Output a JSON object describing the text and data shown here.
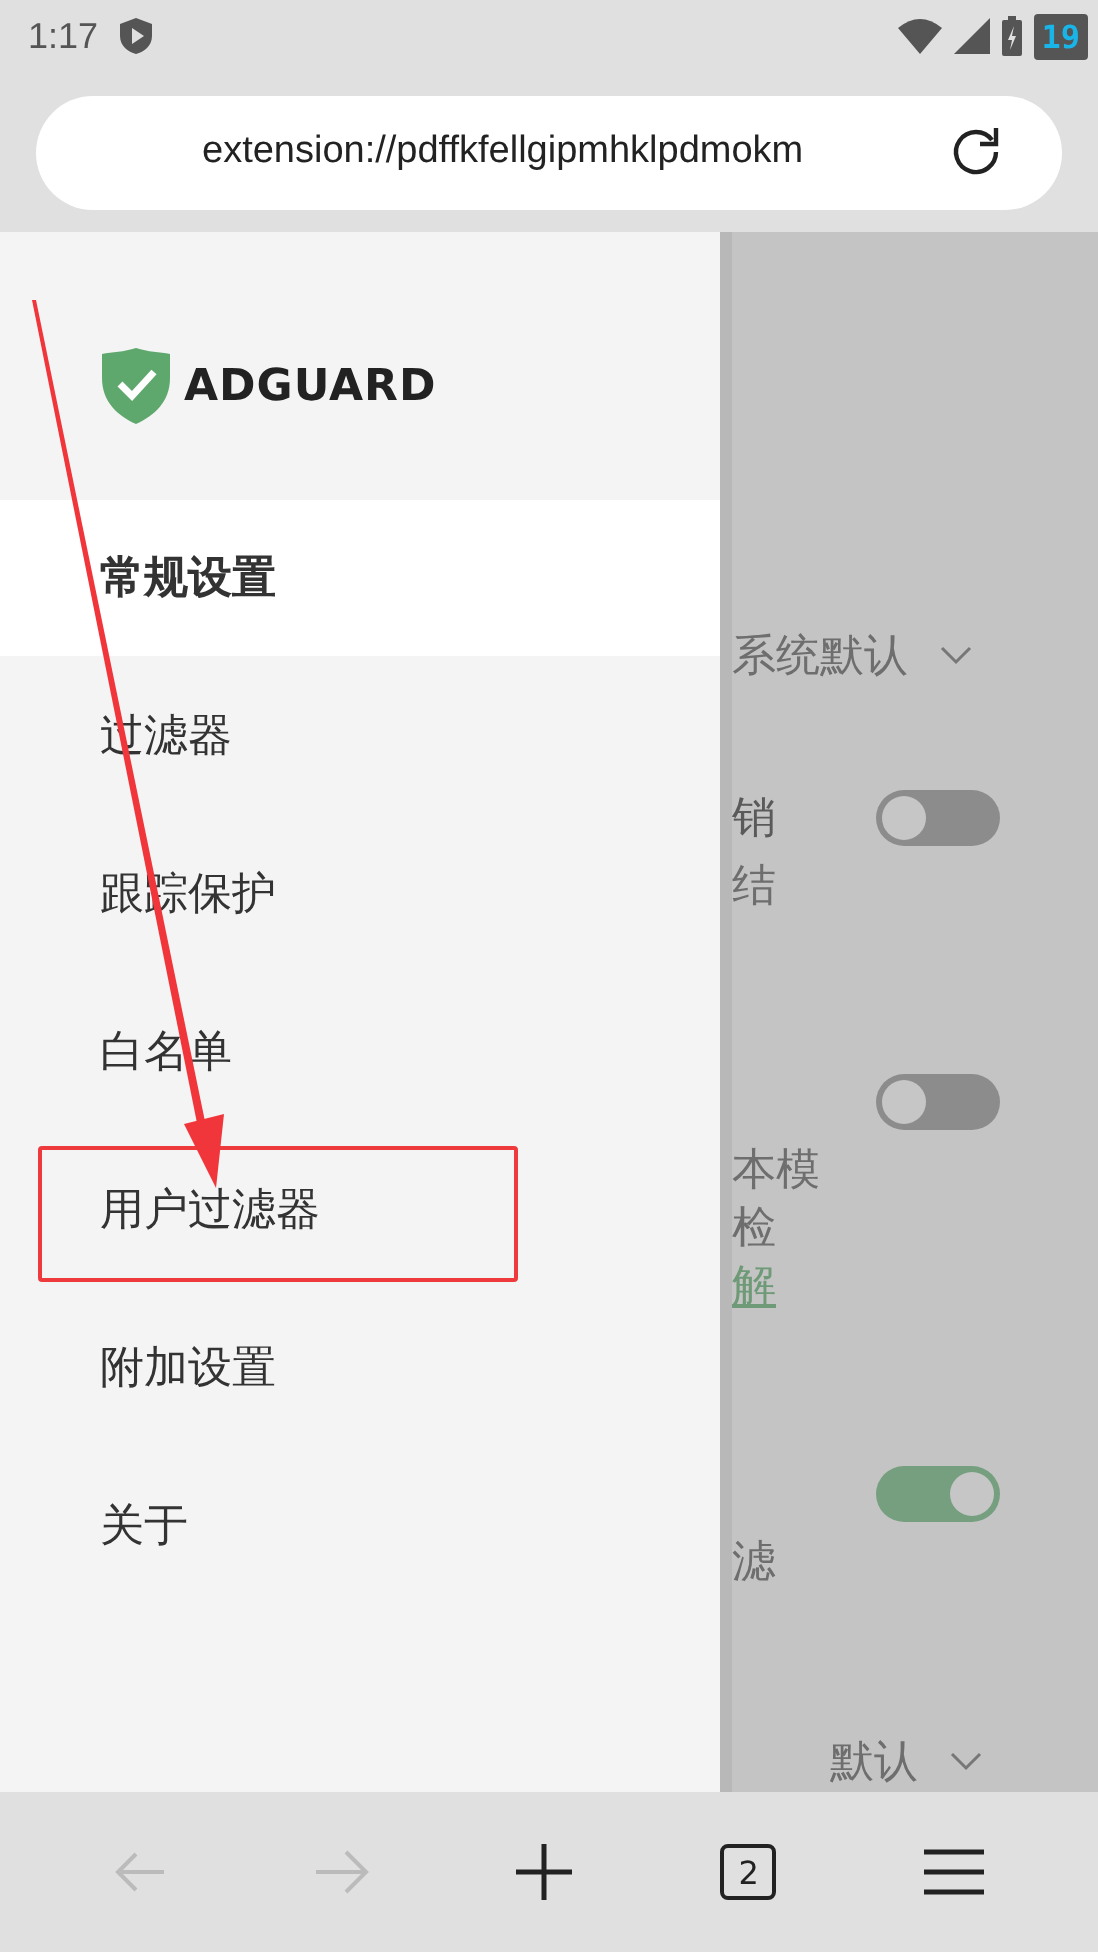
{
  "status_bar": {
    "time": "1:17",
    "badge": "19"
  },
  "address_bar": {
    "url": "extension://pdffkfellgipmhklpdmokm"
  },
  "drawer": {
    "logo": "ADGUARD",
    "items": [
      {
        "label": "常规设置",
        "selected": true,
        "highlighted": false
      },
      {
        "label": "过滤器",
        "selected": false,
        "highlighted": false
      },
      {
        "label": "跟踪保护",
        "selected": false,
        "highlighted": false
      },
      {
        "label": "白名单",
        "selected": false,
        "highlighted": false
      },
      {
        "label": "用户过滤器",
        "selected": false,
        "highlighted": true
      },
      {
        "label": "附加设置",
        "selected": false,
        "highlighted": false
      },
      {
        "label": "关于",
        "selected": false,
        "highlighted": false
      }
    ]
  },
  "background_page": {
    "rows": [
      {
        "kind": "select",
        "value": "系统默认"
      },
      {
        "kind": "toggle",
        "on": false,
        "title": "销",
        "lines": [
          {
            "text": "结",
            "kind": "text"
          }
        ]
      },
      {
        "kind": "toggle",
        "on": false,
        "lines": [
          {
            "text": "本模",
            "kind": "text"
          },
          {
            "text": "检",
            "kind": "text"
          },
          {
            "text": "解",
            "kind": "link"
          }
        ]
      },
      {
        "kind": "toggle",
        "on": true,
        "lines": [
          {
            "text": "滤",
            "kind": "text"
          }
        ]
      },
      {
        "kind": "select",
        "value": "默认"
      }
    ]
  },
  "bottom_bar": {
    "tab_count": "2"
  }
}
